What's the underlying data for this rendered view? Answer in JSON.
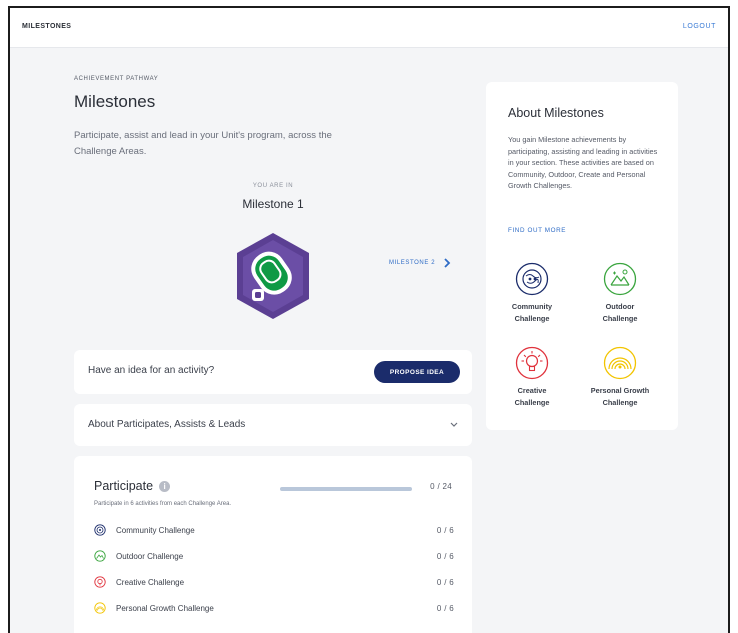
{
  "header": {
    "brand": "MILESTONES",
    "logout": "LOGOUT"
  },
  "main": {
    "eyebrow": "ACHIEVEMENT PATHWAY",
    "title": "Milestones",
    "description": "Participate, assist and lead in your Unit's program, across the Challenge Areas.",
    "you_are_in": "YOU ARE IN",
    "current_milestone": "Milestone 1",
    "next_milestone": "MILESTONE 2",
    "idea_prompt": "Have an idea for an activity?",
    "propose_button": "PROPOSE IDEA",
    "about_pal": "About Participates, Assists & Leads",
    "colors": {
      "badge_purple": "#5b3f93",
      "badge_green": "#0f9a45",
      "button_navy": "#1b2c6b",
      "link_blue": "#2f6cc6"
    }
  },
  "participate": {
    "title": "Participate",
    "count": "0 / 24",
    "progress_fraction": 0,
    "subtitle": "Participate in 6 activities from each Challenge Area.",
    "rows": [
      {
        "icon": "community-icon",
        "label": "Community Challenge",
        "count": "0 / 6",
        "color": "#1b2c6b"
      },
      {
        "icon": "outdoor-icon",
        "label": "Outdoor Challenge",
        "count": "0 / 6",
        "color": "#3aa53e"
      },
      {
        "icon": "creative-icon",
        "label": "Creative Challenge",
        "count": "0 / 6",
        "color": "#e0323c"
      },
      {
        "icon": "personal-growth-icon",
        "label": "Personal Growth Challenge",
        "count": "0 / 6",
        "color": "#f2c400"
      }
    ]
  },
  "sidebar": {
    "title": "About Milestones",
    "description": "You gain Milestone achievements by participating, assisting and leading in activities in your section. These activities are based on Community, Outdoor, Create and Personal Growth Challenges.",
    "find_out_more": "FIND OUT MORE",
    "challenge_areas": [
      {
        "line1": "Community",
        "line2": "Challenge",
        "icon": "community-icon",
        "color": "#1b2c6b"
      },
      {
        "line1": "Outdoor",
        "line2": "Challenge",
        "icon": "outdoor-icon",
        "color": "#3aa53e"
      },
      {
        "line1": "Creative",
        "line2": "Challenge",
        "icon": "creative-icon",
        "color": "#e0323c"
      },
      {
        "line1": "Personal Growth",
        "line2": "Challenge",
        "icon": "personal-growth-icon",
        "color": "#f2c400"
      }
    ]
  }
}
